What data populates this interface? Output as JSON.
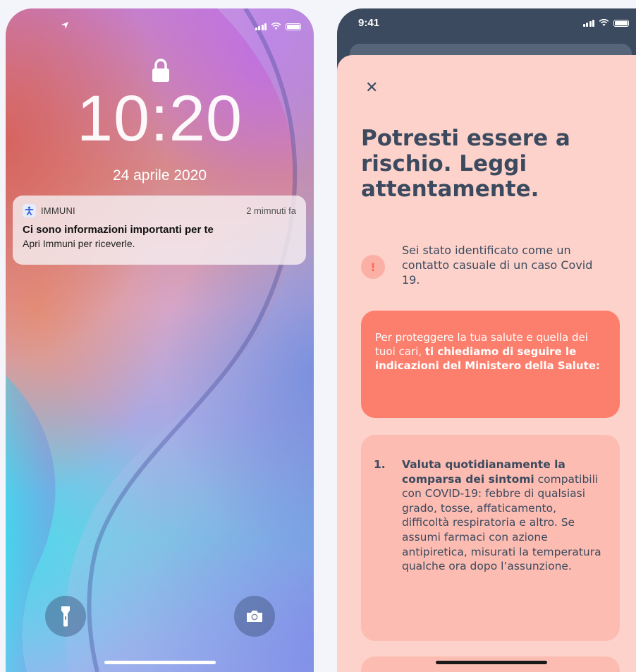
{
  "lock_screen": {
    "time": "10:20",
    "date": "24 aprile 2020",
    "notification": {
      "app_name": "IMMUNI",
      "time_ago": "2 mimnuti fa",
      "title": "Ci sono informazioni importanti per te",
      "body": "Apri Immuni per riceverle."
    },
    "icons": {
      "location": "location-arrow-icon",
      "signal": "signal-icon",
      "wifi": "wifi-icon",
      "battery": "battery-icon",
      "lock": "lock-icon",
      "flashlight": "flashlight-icon",
      "camera": "camera-icon"
    }
  },
  "immuni_screen": {
    "status_time": "9:41",
    "close_icon": "close-icon",
    "title": "Potresti essere a rischio. Leggi attentamente.",
    "alert_text": "Sei stato identificato come un contatto casuale di un caso Covid 19.",
    "red_card": {
      "plain": "Per proteggere la tua salute e quella dei tuoi cari, ",
      "bold": "ti chiediamo di seguire le indicazioni del Ministero della Salute:"
    },
    "steps": [
      {
        "number": "1.",
        "bold": "Valuta quotidianamente la comparsa dei sintomi",
        "text": " compatibili con COVID-19: febbre di qualsiasi grado, tosse, affaticamento, difficoltà respiratoria e altro. Se assumi farmaci con azione antipiretica, misurati la temperatura qualche ora dopo l’assunzione."
      }
    ]
  },
  "colors": {
    "navy": "#3b4a5e",
    "sheet_bg": "#fdd2cb",
    "red_card": "#fc7e6c",
    "pink_card": "#fdbcb2"
  }
}
